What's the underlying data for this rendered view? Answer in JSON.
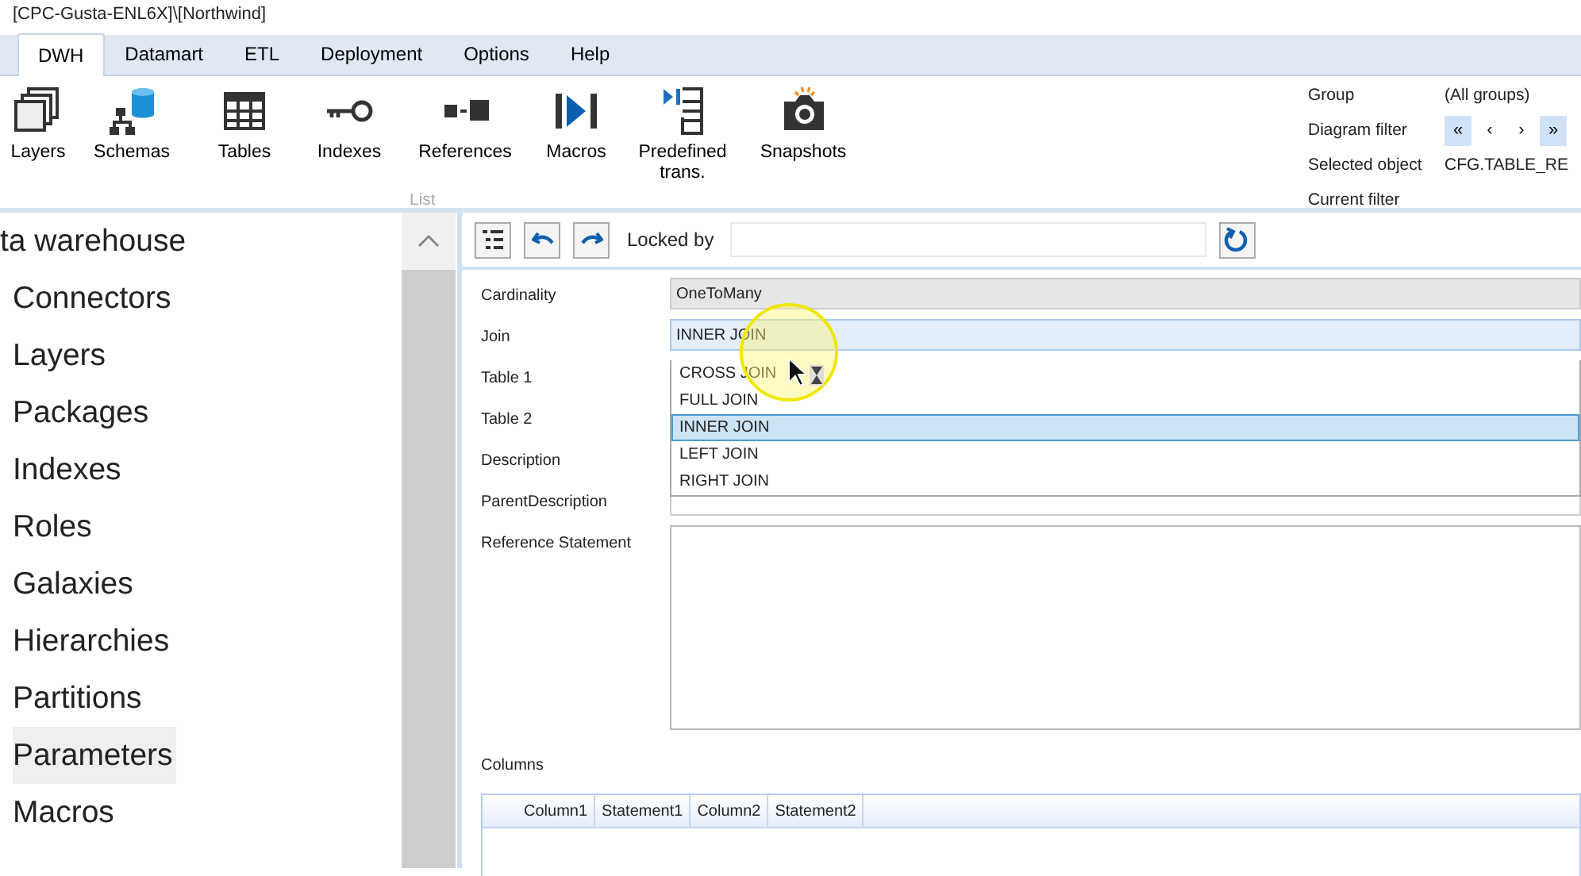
{
  "window": {
    "title": "[CPC-Gusta-ENL6X]\\[Northwind]"
  },
  "ribbon_tabs": [
    {
      "label": "DWH",
      "selected": true
    },
    {
      "label": "Datamart",
      "selected": false
    },
    {
      "label": "ETL",
      "selected": false
    },
    {
      "label": "Deployment",
      "selected": false
    },
    {
      "label": "Options",
      "selected": false
    },
    {
      "label": "Help",
      "selected": false
    }
  ],
  "ribbon_buttons": [
    {
      "label": "Layers",
      "kind": "layers"
    },
    {
      "label": "Schemas",
      "kind": "schemas"
    },
    {
      "label": "Tables",
      "kind": "tables"
    },
    {
      "label": "Indexes",
      "kind": "indexes"
    },
    {
      "label": "References",
      "kind": "references"
    },
    {
      "label": "Macros",
      "kind": "macros"
    },
    {
      "label": "Predefined trans.",
      "kind": "predefined"
    },
    {
      "label": "Snapshots",
      "kind": "snapshots"
    }
  ],
  "ribbon_group_label": "List",
  "filter_panel": {
    "group": {
      "label": "Group",
      "value": "(All groups)"
    },
    "diagram_filter": {
      "label": "Diagram filter",
      "buttons": [
        {
          "label": "«",
          "active": true
        },
        {
          "label": "‹",
          "active": false
        },
        {
          "label": "›",
          "active": false
        },
        {
          "label": "»",
          "active": true
        }
      ]
    },
    "selected_object": {
      "label": "Selected object",
      "value": "CFG.TABLE_RE"
    },
    "current_filter": {
      "label": "Current filter"
    }
  },
  "tree": {
    "items": [
      {
        "label": "ta warehouse",
        "selected": false,
        "children": [
          {
            "label": "Connectors",
            "selected": false
          },
          {
            "label": "Layers",
            "selected": false
          },
          {
            "label": "Packages",
            "selected": false
          },
          {
            "label": "Indexes",
            "selected": false
          },
          {
            "label": "Roles",
            "selected": false
          },
          {
            "label": "Galaxies",
            "selected": false
          },
          {
            "label": "Hierarchies",
            "selected": false
          },
          {
            "label": "Partitions",
            "selected": false
          },
          {
            "label": "Parameters",
            "selected": true
          },
          {
            "label": "Macros",
            "selected": false
          }
        ]
      }
    ]
  },
  "editor": {
    "toolbar": {
      "locked_by_label": "Locked by"
    },
    "cardinality": {
      "label": "Cardinality",
      "value": "OneToMany"
    },
    "join": {
      "label": "Join",
      "value": "INNER JOIN",
      "expanded": true,
      "options": [
        {
          "label": "CROSS JOIN",
          "selected": false
        },
        {
          "label": "FULL JOIN",
          "selected": false
        },
        {
          "label": "INNER JOIN",
          "selected": true
        },
        {
          "label": "LEFT JOIN",
          "selected": false
        },
        {
          "label": "RIGHT JOIN",
          "selected": false
        }
      ]
    },
    "rows": [
      {
        "label": "Table 1"
      },
      {
        "label": "Table 2"
      },
      {
        "label": "Description"
      },
      {
        "label": "ParentDescription",
        "kind": "field"
      }
    ],
    "reference_statement": {
      "label": "Reference Statement"
    },
    "columns": {
      "label": "Columns",
      "grid_columns": [
        "Column1",
        "Statement1",
        "Column2",
        "Statement2"
      ]
    }
  }
}
